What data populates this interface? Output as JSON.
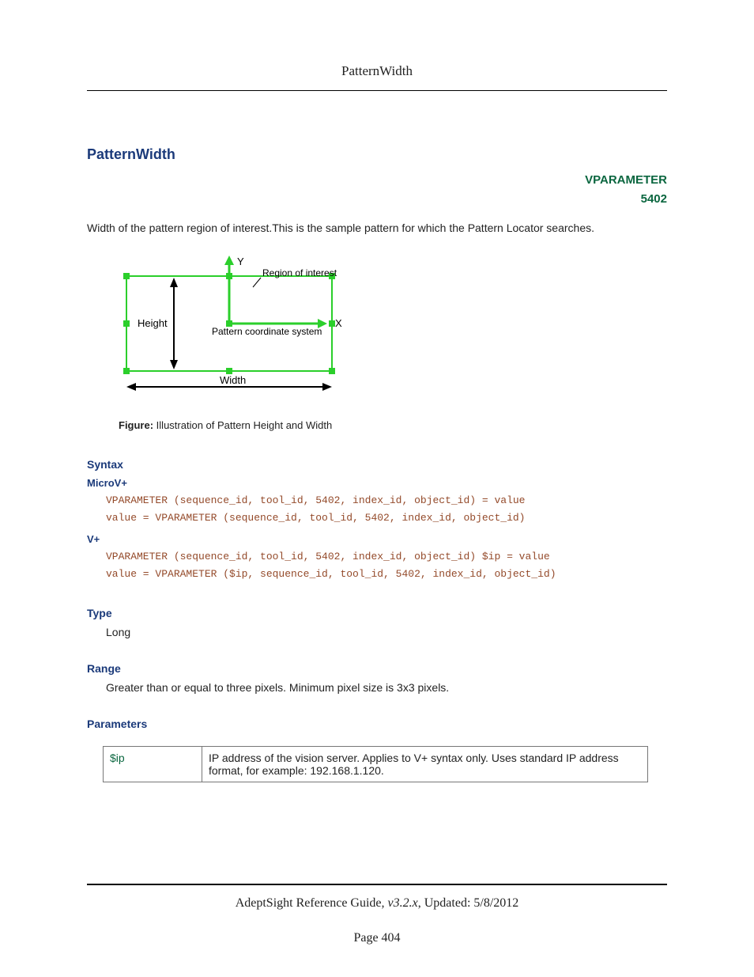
{
  "header": {
    "title": "PatternWidth"
  },
  "section": {
    "title": "PatternWidth",
    "vparameter_label": "VPARAMETER",
    "vparameter_number": "5402",
    "description": "Width of the pattern region of interest.This is the sample pattern for which the Pattern Locator searches."
  },
  "figure": {
    "labels": {
      "y_axis": "Y",
      "x_axis": "X",
      "roi": "Region of interest",
      "height": "Height",
      "width": "Width",
      "coord": "Pattern coordinate system"
    },
    "caption_bold": "Figure:",
    "caption_text": " Illustration of Pattern Height and Width"
  },
  "syntax": {
    "heading": "Syntax",
    "microv": {
      "heading": "MicroV+",
      "code": "VPARAMETER (sequence_id, tool_id, 5402, index_id, object_id) = value\nvalue = VPARAMETER (sequence_id, tool_id, 5402, index_id, object_id)"
    },
    "vplus": {
      "heading": "V+",
      "code": "VPARAMETER (sequence_id, tool_id, 5402, index_id, object_id) $ip = value\nvalue = VPARAMETER ($ip, sequence_id, tool_id, 5402, index_id, object_id)"
    }
  },
  "type": {
    "heading": "Type",
    "value": "Long"
  },
  "range": {
    "heading": "Range",
    "value": "Greater than or equal to three pixels. Minimum pixel size is 3x3 pixels."
  },
  "parameters": {
    "heading": "Parameters",
    "rows": [
      {
        "name": "$ip",
        "desc": "IP address of the vision server. Applies to V+ syntax only. Uses standard IP address format, for example: 192.168.1.120."
      }
    ]
  },
  "footer": {
    "guide": "AdeptSight Reference Guide",
    "version": ", v3.2.x",
    "updated_prefix": ", Updated: ",
    "updated": "5/8/2012",
    "page_prefix": "Page ",
    "page_number": "404"
  }
}
